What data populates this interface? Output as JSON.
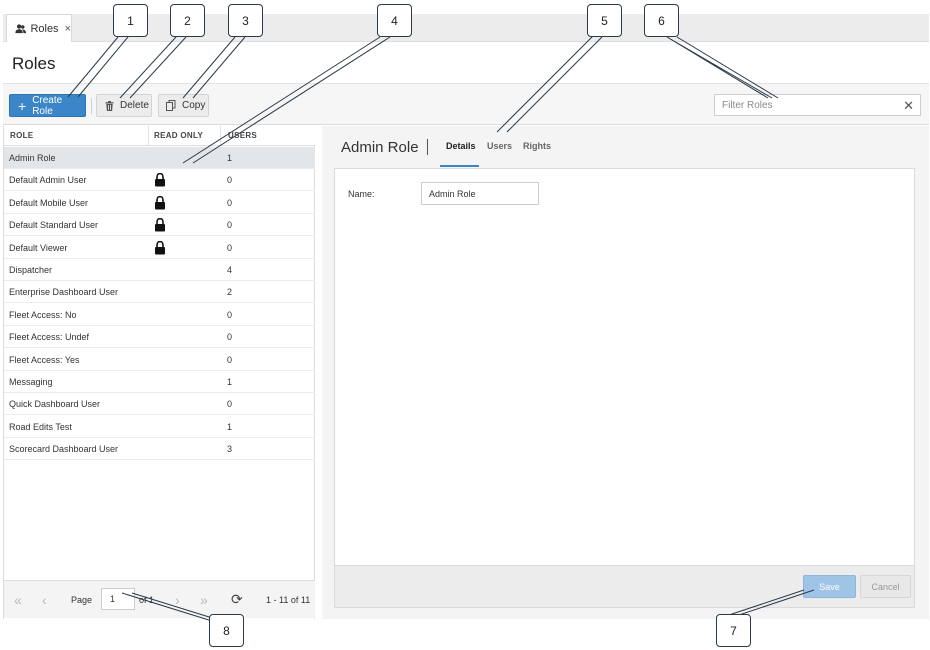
{
  "tab": {
    "label": "Roles",
    "icon": "users-icon",
    "close": "×"
  },
  "page": {
    "title": "Roles"
  },
  "toolbar": {
    "create_label": "Create Role",
    "create_plus": "+",
    "delete_label": "Delete",
    "copy_label": "Copy",
    "filter_placeholder": "Filter Roles",
    "filter_clear": "✕"
  },
  "grid": {
    "columns": [
      "ROLE",
      "READ ONLY",
      "USERS"
    ],
    "rows": [
      {
        "name": "Admin Role",
        "read_only": false,
        "users": "1",
        "selected": true
      },
      {
        "name": "Default Admin User",
        "read_only": true,
        "users": "0"
      },
      {
        "name": "Default Mobile User",
        "read_only": true,
        "users": "0"
      },
      {
        "name": "Default Standard User",
        "read_only": true,
        "users": "0"
      },
      {
        "name": "Default Viewer",
        "read_only": true,
        "users": "0"
      },
      {
        "name": "Dispatcher",
        "read_only": false,
        "users": "4"
      },
      {
        "name": "Enterprise Dashboard User",
        "read_only": false,
        "users": "2"
      },
      {
        "name": "Fleet Access: No",
        "read_only": false,
        "users": "0"
      },
      {
        "name": "Fleet Access: Undef",
        "read_only": false,
        "users": "0"
      },
      {
        "name": "Fleet Access: Yes",
        "read_only": false,
        "users": "0"
      },
      {
        "name": "Messaging",
        "read_only": false,
        "users": "1"
      },
      {
        "name": "Quick Dashboard User",
        "read_only": false,
        "users": "0"
      },
      {
        "name": "Road Edits Test",
        "read_only": false,
        "users": "1"
      },
      {
        "name": "Scorecard Dashboard User",
        "read_only": false,
        "users": "3"
      }
    ]
  },
  "pager": {
    "page_label": "Page",
    "page_value": "1",
    "of_label": "of 1",
    "summary": "1 - 11 of 11",
    "first": "«",
    "prev": "‹",
    "next": "›",
    "last": "»",
    "refresh": "⟳"
  },
  "detail": {
    "title": "Admin Role",
    "tabs": [
      "Details",
      "Users",
      "Rights"
    ],
    "active_tab": "Details",
    "name_label": "Name:",
    "name_value": "Admin Role",
    "save_label": "Save",
    "cancel_label": "Cancel"
  },
  "callouts": [
    "1",
    "2",
    "3",
    "4",
    "5",
    "6",
    "7",
    "8"
  ],
  "colors": {
    "primary": "#3a86c8",
    "save_disabled": "#9fc4e6",
    "selected_row": "#e3e6e9"
  }
}
